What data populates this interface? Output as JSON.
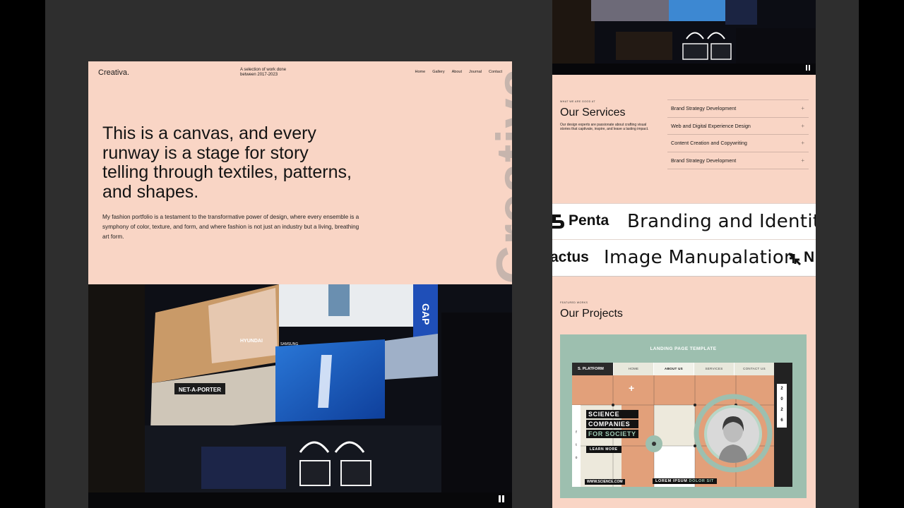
{
  "left_site": {
    "logo": "Creativa.",
    "tagline_line1": "A selection of work done",
    "tagline_line2": "between 2017-2023",
    "nav": [
      "Home",
      "Gallery",
      "About",
      "Journal",
      "Contact"
    ],
    "headline": "This is a canvas, and every runway is a stage for story telling through textiles, patterns, and shapes.",
    "intro": "My fashion portfolio is a testament to the transformative power of design, where every ensemble is a symphony of color, texture, and form, and where fashion is not just an industry but a living, breathing art form.",
    "vertical_brand": "Creativa",
    "billboard_texts": [
      "NET-A-PORTER",
      "HYUNDAI",
      "SAMSUNG",
      "GAP"
    ]
  },
  "right_site": {
    "services": {
      "eyebrow": "WHAT WE ARE GOOD AT",
      "title": "Our Services",
      "description": "Our design experts are passionate about crafting visual stories that captivate, inspire, and leave a lasting impact.",
      "items": [
        "Brand Strategy Development",
        "Web and Digital Experience Design",
        "Content Creation and Copywriting",
        "Brand Strategy Development"
      ],
      "expand_symbol": "+"
    },
    "marquee": {
      "row1_brand": "Penta",
      "row1_text": "Branding and Identity",
      "row2_brand": "Cactus",
      "row2_brand_visible": "actus",
      "row2_text": "Image Manupalation",
      "row2_trailing": "N"
    },
    "projects": {
      "eyebrow": "FEATURED WORKS",
      "title": "Our Projects",
      "card_label": "LANDING PAGE TEMPLATE",
      "template": {
        "logo": "S. PLATFORM",
        "nav": [
          "HOME",
          "ABOUT US",
          "SERVICES",
          "CONTACT US"
        ],
        "active_nav": "ABOUT US",
        "headline_lines": [
          "SCIENCE",
          "COMPANIES",
          "FOR SOCIETY"
        ],
        "button": "LEARN MORE",
        "url": "WWW.SCIENCE.COM",
        "lorem_a": "LOREM IPSUM",
        "lorem_b": "DOLOR SIT",
        "year_digits": [
          "2",
          "0",
          "2",
          "6"
        ],
        "social_icons": [
          "f",
          "t",
          "o"
        ]
      }
    }
  },
  "colors": {
    "peach": "#f9d5c5",
    "backdrop": "#2e2e2e",
    "sage": "#9dbfaf",
    "terracotta": "#e2a07a"
  },
  "icons": [
    "pause-icon",
    "plus-icon",
    "penta-logo-icon",
    "arrows-logo-icon"
  ]
}
